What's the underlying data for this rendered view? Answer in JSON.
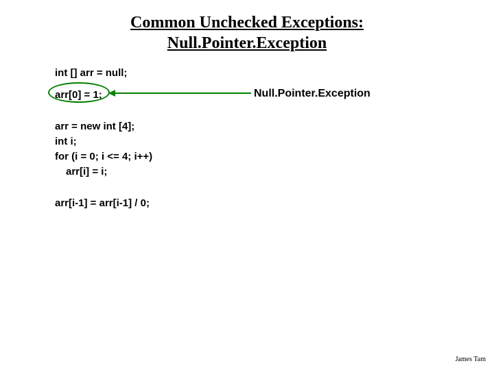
{
  "title_line1": "Common Unchecked Exceptions:",
  "title_line2": "Null.Pointer.Exception",
  "code": {
    "l1": "int [] arr = null;",
    "l2": "arr[0] = 1;",
    "l3": "arr = new int [4];",
    "l4": "int i;",
    "l5": "for (i = 0; i <= 4; i++)",
    "l6": "arr[i] = i;",
    "l7": "arr[i-1] = arr[i-1] / 0;"
  },
  "callout": "Null.Pointer.Exception",
  "footer": "James Tam",
  "colors": {
    "highlight": "#008000"
  }
}
